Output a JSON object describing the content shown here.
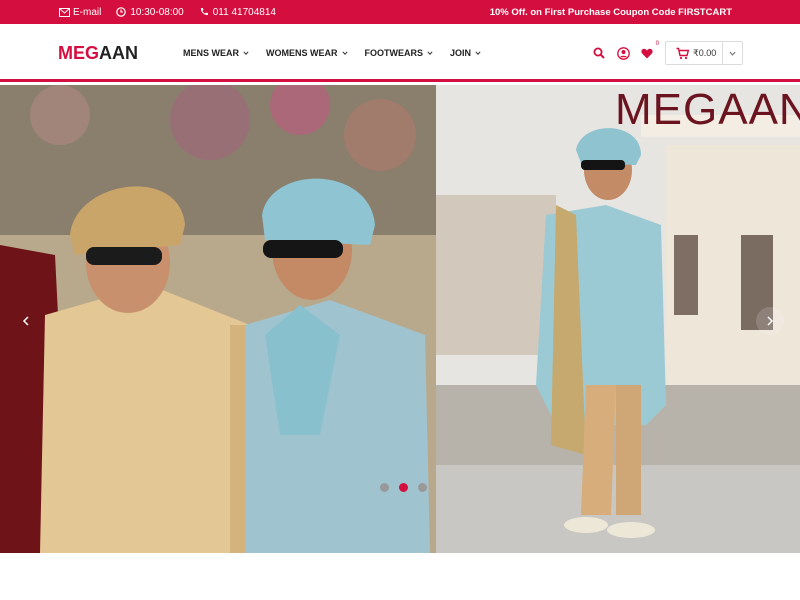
{
  "topbar": {
    "email_label": "E-mail",
    "hours": "10:30-08:00",
    "phone": "011 41704814",
    "promo": "10% Off. on First Purchase Coupon Code FIRSTCART"
  },
  "header": {
    "logo_part1": "MEG",
    "logo_part2": "AAN",
    "nav": [
      {
        "label": "MENS WEAR"
      },
      {
        "label": "WOMENS WEAR"
      },
      {
        "label": "FOOTWEARS"
      },
      {
        "label": "JOIN"
      }
    ],
    "wishlist_count": "0",
    "cart_amount": "₹0.00"
  },
  "hero": {
    "brand_text": "MEGAAN",
    "slides": 3,
    "active_slide": 1
  },
  "colors": {
    "accent": "#d40f3f",
    "brand_overlay": "#6b1420"
  }
}
